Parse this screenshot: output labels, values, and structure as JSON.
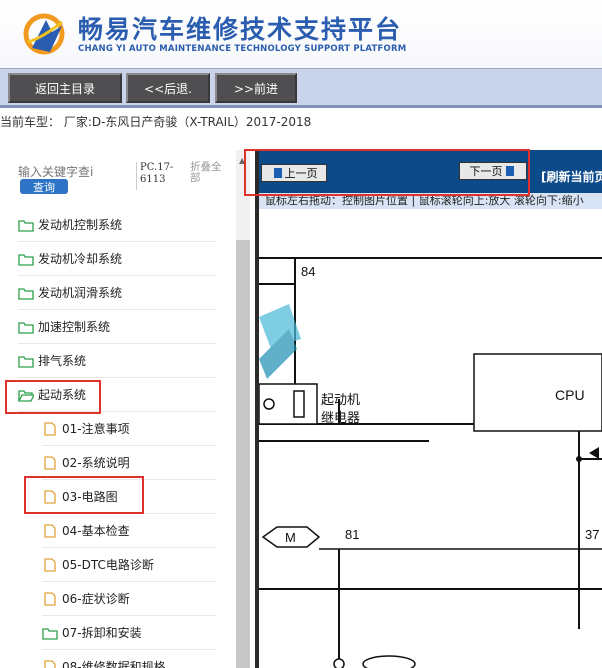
{
  "header": {
    "title": "畅易汽车维修技术支持平台",
    "subtitle": "CHANG YI AUTO MAINTENANCE TECHNOLOGY SUPPORT PLATFORM"
  },
  "toolbar": {
    "back_main": "返回主目录",
    "back": "<<后退.",
    "forward": ">>前进"
  },
  "current_model": "当前车型： 厂家:D-东风日产奇骏（X-TRAIL）2017-2018",
  "search": {
    "placeholder": "输入关键字查i",
    "button": "查询",
    "pc_label": "PC.17-6113",
    "collapse_all": "折叠全部"
  },
  "tree": {
    "items": [
      {
        "label": "发动机控制系统",
        "icon": "folder-icon"
      },
      {
        "label": "发动机冷却系统",
        "icon": "folder-icon"
      },
      {
        "label": "发动机润滑系统",
        "icon": "folder-icon"
      },
      {
        "label": "加速控制系统",
        "icon": "folder-icon"
      },
      {
        "label": "排气系统",
        "icon": "folder-icon"
      },
      {
        "label": "起动系统",
        "icon": "folder-open-icon"
      }
    ],
    "children": [
      {
        "label": "01-注意事项",
        "icon": "document-icon"
      },
      {
        "label": "02-系统说明",
        "icon": "document-icon"
      },
      {
        "label": "03-电路图",
        "icon": "document-icon"
      },
      {
        "label": "04-基本检查",
        "icon": "document-icon"
      },
      {
        "label": "05-DTC电路诊断",
        "icon": "document-icon"
      },
      {
        "label": "06-症状诊断",
        "icon": "document-icon"
      },
      {
        "label": "07-拆卸和安装",
        "icon": "folder-icon"
      },
      {
        "label": "08-维修数据和规格",
        "icon": "document-icon"
      }
    ]
  },
  "viewer": {
    "prev_page": "上一页",
    "next_page": "下一页",
    "refresh": "[刷新当前页",
    "hint": "鼠标左右拖动：控制图片位置 | 鼠标滚轮向上:放大  滚轮向下:缩小"
  },
  "diagram": {
    "wire_84": "84",
    "relay_label_1": "起动机",
    "relay_label_2": "继电器",
    "cpu": "CPU",
    "connector_m": "M",
    "wire_81": "81",
    "wire_37": "37"
  },
  "colors": {
    "brand": "#2a5db0",
    "toolbar": "#c9d3ea",
    "viewer_bar": "#0d4a8a",
    "highlight": "#e0322d",
    "search_button": "#2d73c6"
  }
}
